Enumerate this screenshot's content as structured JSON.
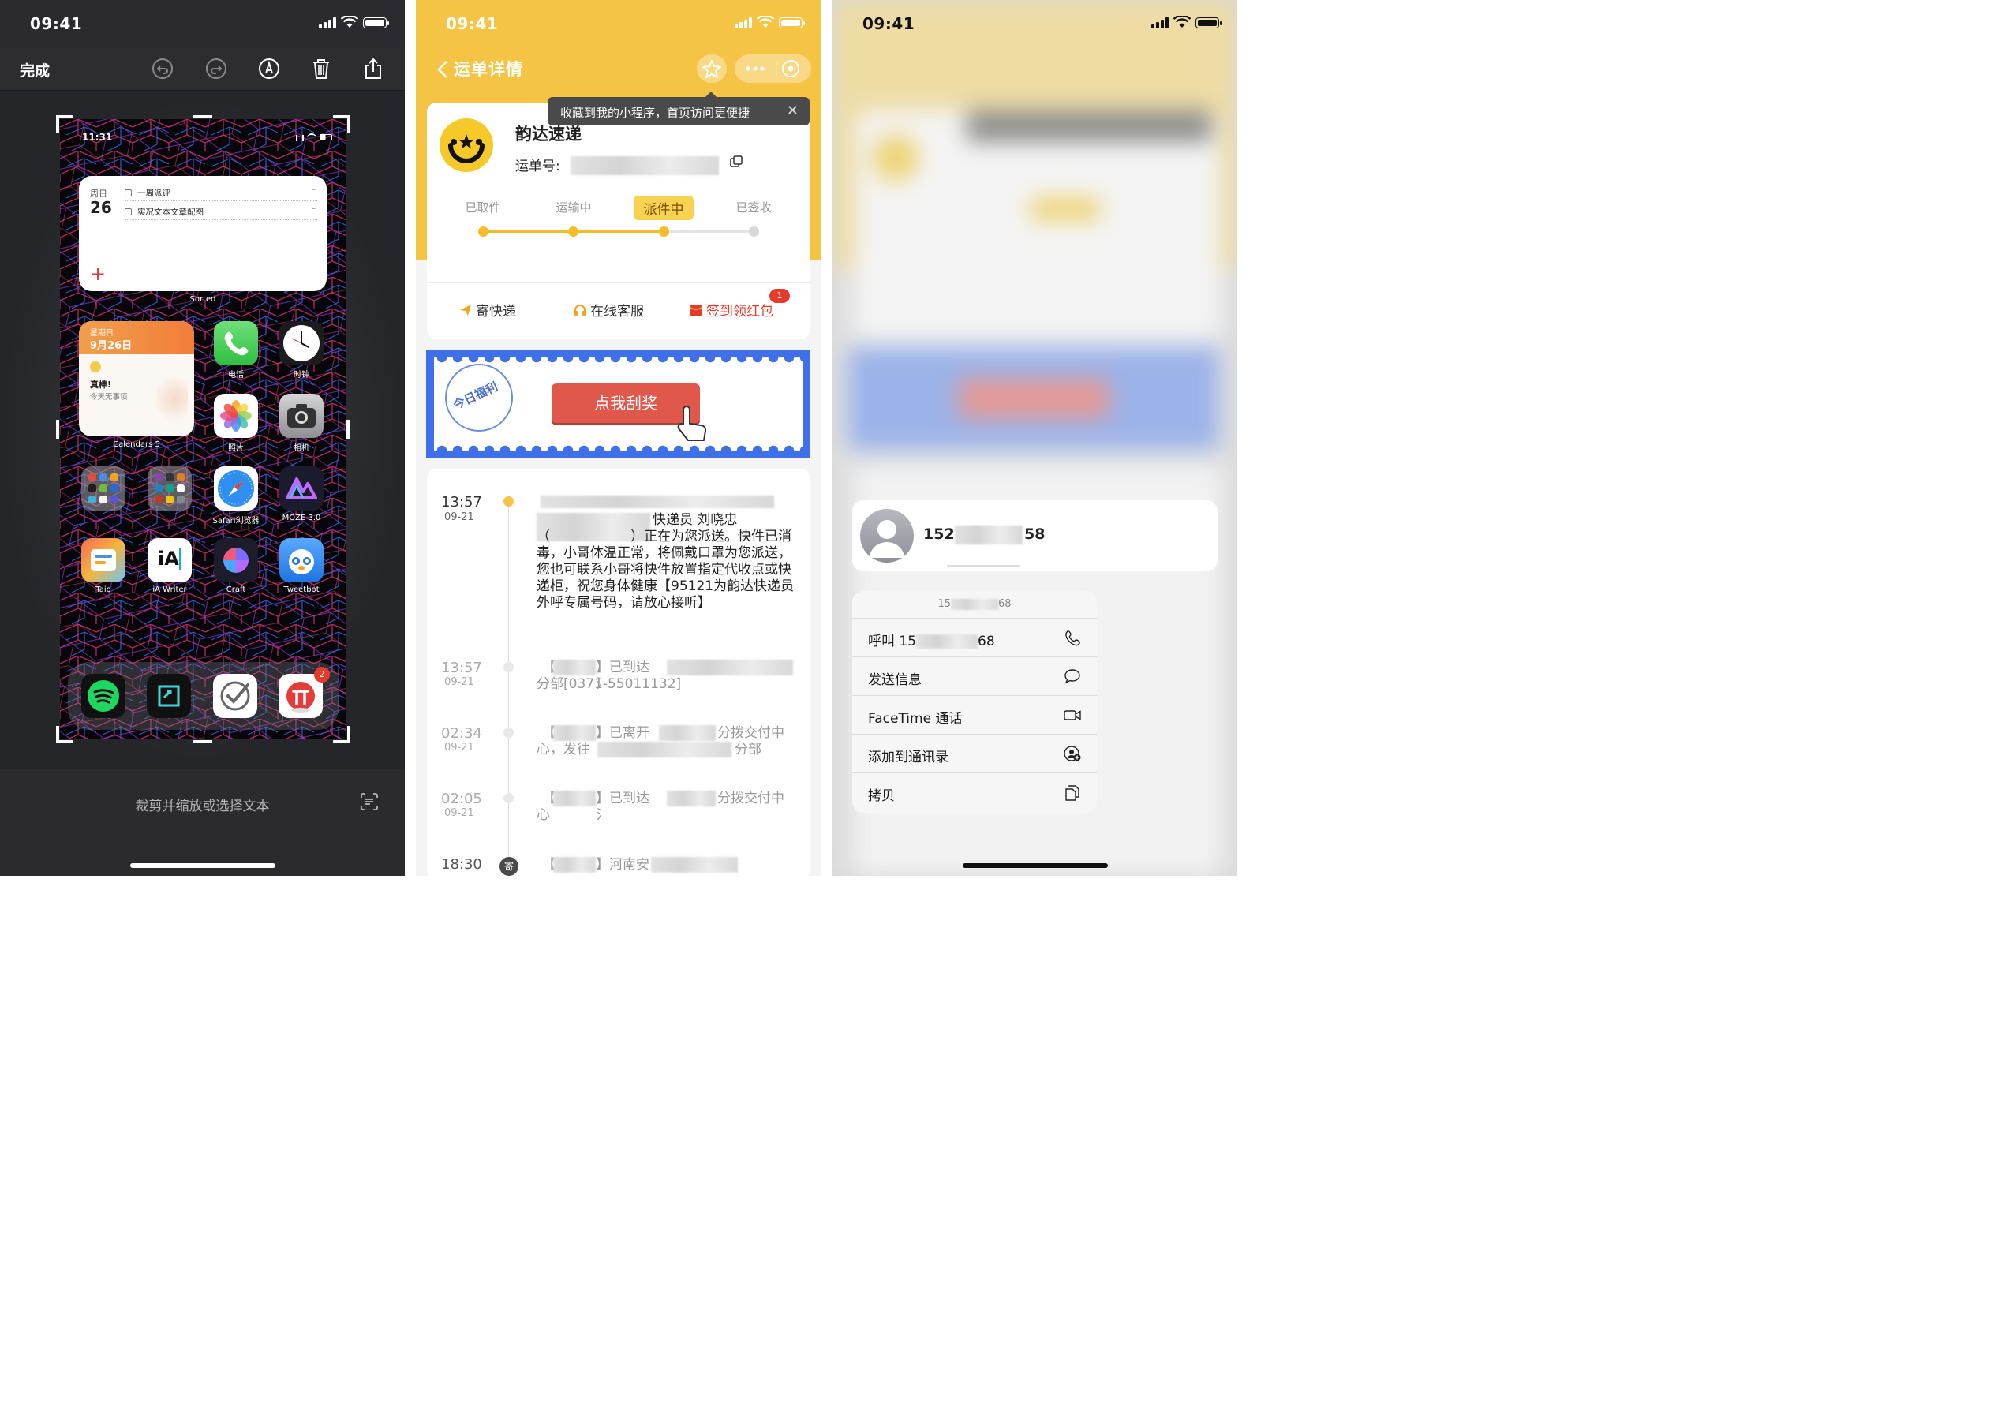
{
  "panel1": {
    "status_time": "09:41",
    "toolbar": {
      "done": "完成"
    },
    "screenshot": {
      "time": "11:31",
      "sorted_widget": {
        "day_label": "周日",
        "day_number": "26",
        "tasks": [
          "一周派评",
          "实况文本文章配图"
        ],
        "add": "+",
        "caption": "Sorted"
      },
      "calendar_widget": {
        "weekday": "星期日",
        "date": "9月26日",
        "message": "真棒!",
        "sub": "今天无事项",
        "caption": "Calendars 5"
      },
      "apps": [
        {
          "label": "电话",
          "icon": "phone-icon"
        },
        {
          "label": "时钟",
          "icon": "clock-icon"
        },
        {
          "label": "照片",
          "icon": "photos-icon"
        },
        {
          "label": "相机",
          "icon": "camera-icon"
        },
        {
          "label": "",
          "icon": "folder-icon"
        },
        {
          "label": "",
          "icon": "folder-icon"
        },
        {
          "label": "Safari浏览器",
          "icon": "safari-icon"
        },
        {
          "label": "MOZE 3.0",
          "icon": "moze-icon"
        },
        {
          "label": "Taio",
          "icon": "taio-icon"
        },
        {
          "label": "iA Writer",
          "icon": "ia-writer-icon"
        },
        {
          "label": "Craft",
          "icon": "craft-icon"
        },
        {
          "label": "Tweetbot",
          "icon": "tweetbot-icon"
        }
      ],
      "ia_text": "iA",
      "dock": [
        "spotify-icon",
        "screenshot-app-icon",
        "omnifocus-icon",
        "pi-app-icon"
      ],
      "dock_badge": "2"
    },
    "bottom_text": "裁剪并缩放或选择文本"
  },
  "panel2": {
    "status_time": "09:41",
    "nav_title": "运单详情",
    "tooltip": "收藏到我的小程序，首页访问更便捷",
    "company": "韵达速递",
    "waybill_label": "运单号:",
    "steps": [
      "已取件",
      "运输中",
      "派件中",
      "已签收"
    ],
    "active_step": 2,
    "actions": [
      "寄快递",
      "在线客服",
      "签到领红包"
    ],
    "badge": "1",
    "promo_stamp": "今日福利",
    "promo_button": "点我刮奖",
    "timeline": [
      {
        "time": "13:57",
        "date": "09-21",
        "text_top": "快递员 刘晓忠",
        "text_body": "（　　　　　　）正在为您派送。快件已消毒，小哥体温正常，将佩戴口罩为您派送，您也可联系小哥将快件放置指定代收点或快递柜，祝您身体健康【95121为韵达快递员外呼专属号码，请放心接听】"
      },
      {
        "time": "13:57",
        "date": "09-21",
        "text_a": "【",
        "text_b": "】已到达 氵",
        "text_c": "分部[0371-55011132]"
      },
      {
        "time": "02:34",
        "date": "09-21",
        "text_a": "【",
        "text_b": "】已离开",
        "text_c": "分拨交付中",
        "text_d": "心，发往",
        "text_e": "分部"
      },
      {
        "time": "02:05",
        "date": "09-21",
        "text_a": "【",
        "text_b": "】已到达 氵",
        "text_c": "分拨交付中",
        "text_d": "心"
      },
      {
        "time": "18:30",
        "date": "09-20",
        "text_a": "【",
        "text_b": "】河南安",
        "dot_label": "寄"
      }
    ]
  },
  "panel3": {
    "status_time": "09:41",
    "contact_number_prefix": "152",
    "contact_number_suffix": "58",
    "menu_header_prefix": "15",
    "menu_header_suffix": "68",
    "menu_items": [
      {
        "label_prefix": "呼叫 15",
        "label_suffix": "68",
        "icon": "phone-icon"
      },
      {
        "label": "发送信息",
        "icon": "message-icon"
      },
      {
        "label": "FaceTime 通话",
        "icon": "video-icon"
      },
      {
        "label": "添加到通讯录",
        "icon": "add-contact-icon"
      },
      {
        "label": "拷贝",
        "icon": "copy-icon"
      }
    ]
  },
  "colors": {
    "yunda_yellow": "#f6c445",
    "promo_blue": "#3f6fe9",
    "scratch_red": "#e0574c",
    "accent_red": "#e23b2e"
  }
}
